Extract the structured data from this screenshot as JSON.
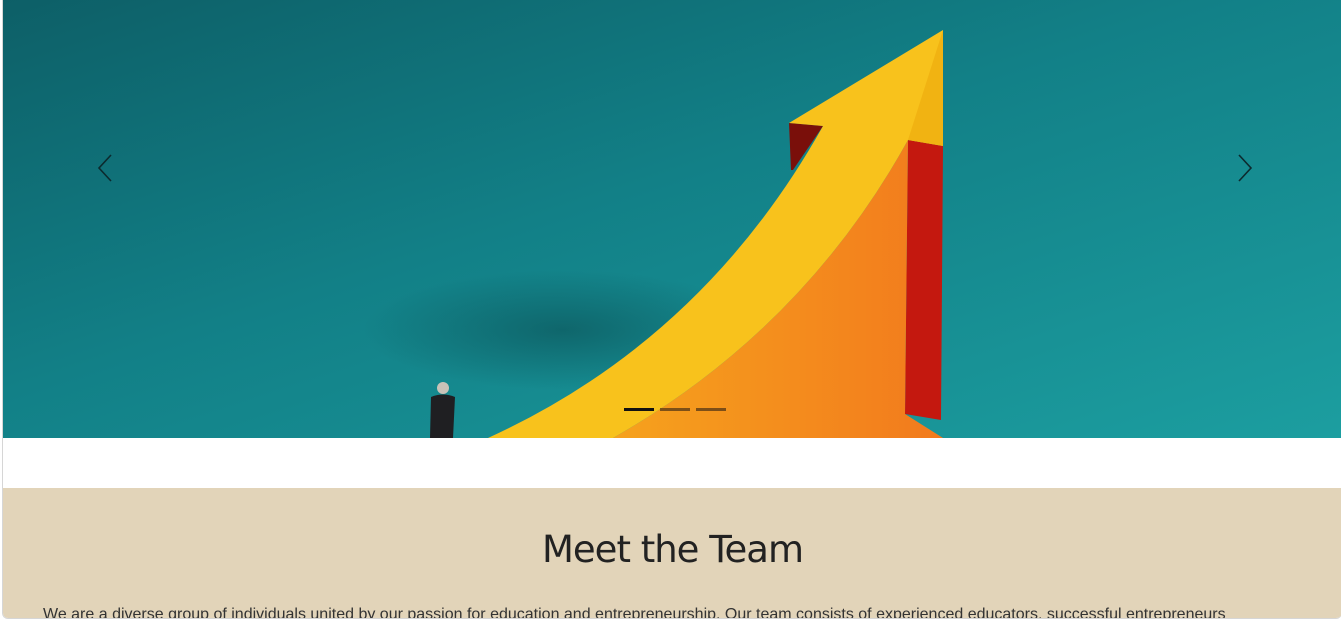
{
  "carousel": {
    "prev_icon": "chevron-left-icon",
    "next_icon": "chevron-right-icon",
    "slide_count": 3,
    "active_slide": 1
  },
  "team_section": {
    "title": "Meet the Team",
    "description": "We are a diverse group of individuals united by our passion for education and entrepreneurship. Our team consists of experienced educators, successful entrepreneurs"
  },
  "colors": {
    "teal_background": "#148a8f",
    "arrow_yellow": "#f8c21c",
    "arrow_orange": "#f5861f",
    "arrow_red": "#c4180f",
    "section_beige": "#e2d4b9"
  }
}
